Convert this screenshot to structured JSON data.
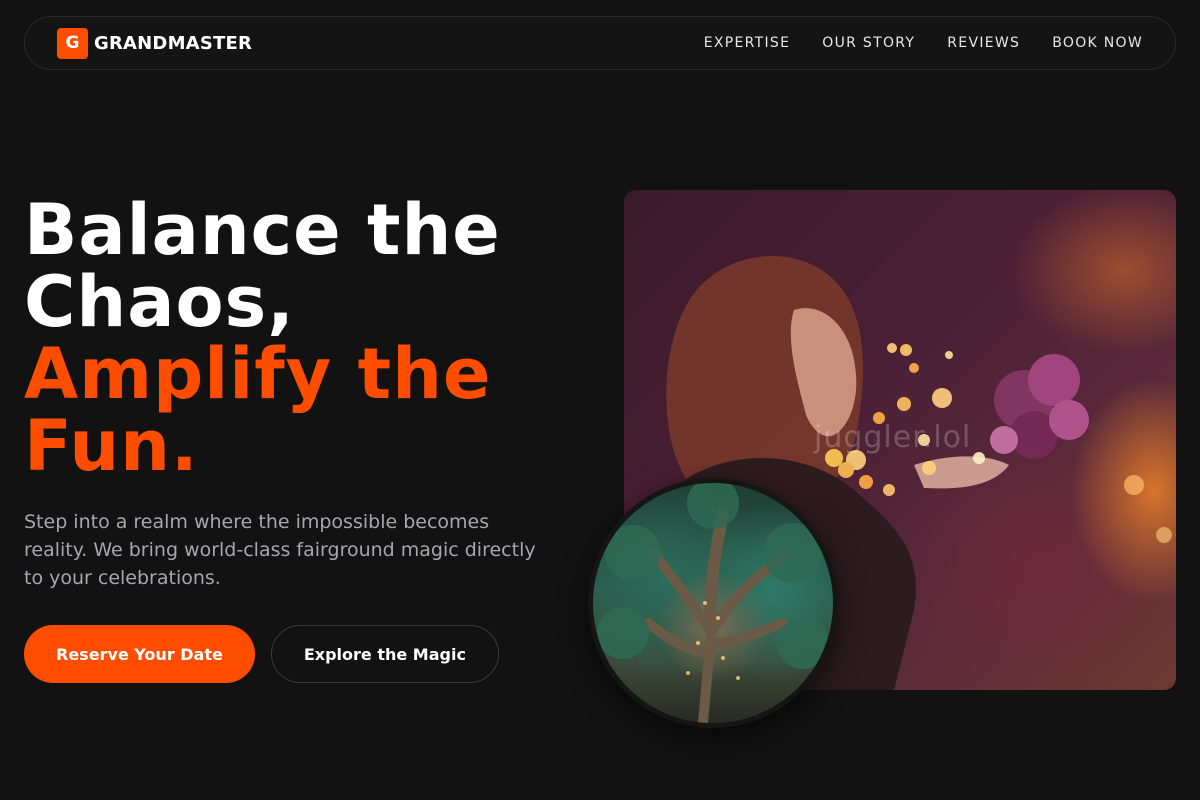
{
  "brand": {
    "mark": "G",
    "name": "GRANDMASTER"
  },
  "nav": {
    "links": [
      "EXPERTISE",
      "OUR STORY",
      "REVIEWS",
      "BOOK NOW"
    ]
  },
  "hero": {
    "headline_line1": "Balance the",
    "headline_line2": "Chaos,",
    "headline_line3": "Amplify the",
    "headline_line4": "Fun.",
    "lede": "Step into a realm where the impossible becomes reality. We bring world-class fairground magic directly to your celebrations.",
    "primary_cta": "Reserve Your Date",
    "secondary_cta": "Explore the Magic"
  },
  "media": {
    "main_photo_watermark": "juggler.lol"
  },
  "colors": {
    "background": "#121212",
    "accent": "#ff4d00",
    "muted_text": "#a6a6ad"
  }
}
